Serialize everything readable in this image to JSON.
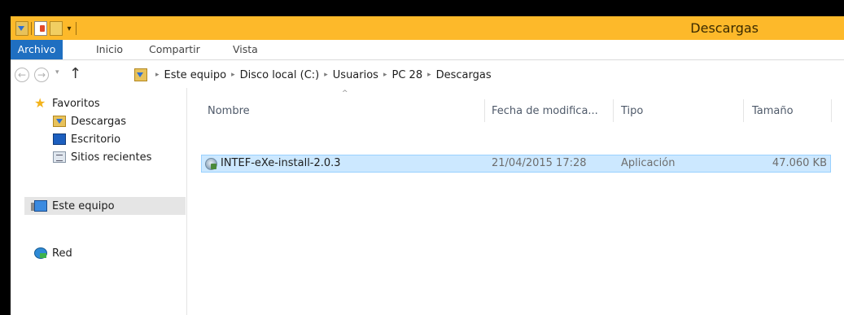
{
  "window": {
    "title": "Descargas"
  },
  "quick_access": {
    "icons": [
      "download-folder-icon",
      "properties-icon",
      "new-folder-icon"
    ],
    "customize": "▾"
  },
  "ribbon": {
    "tabs": [
      {
        "label": "Archivo",
        "active": true
      },
      {
        "label": "Inicio"
      },
      {
        "label": "Compartir"
      },
      {
        "label": "Vista"
      }
    ]
  },
  "address": {
    "back": "←",
    "forward": "→",
    "history": "▾",
    "up": "↑",
    "separator": "▸",
    "crumbs": [
      "Este equipo",
      "Disco local (C:)",
      "Usuarios",
      "PC 28",
      "Descargas"
    ]
  },
  "navpane": {
    "favorites": {
      "label": "Favoritos",
      "icon": "star-icon"
    },
    "fav_items": [
      {
        "label": "Descargas",
        "icon": "download-folder-icon"
      },
      {
        "label": "Escritorio",
        "icon": "desktop-icon"
      },
      {
        "label": "Sitios recientes",
        "icon": "recent-places-icon"
      }
    ],
    "this_pc": {
      "label": "Este equipo",
      "icon": "computer-icon",
      "selected": true
    },
    "network": {
      "label": "Red",
      "icon": "network-icon"
    }
  },
  "filelist": {
    "sort_indicator": "^",
    "columns": [
      "Nombre",
      "Fecha de modifica...",
      "Tipo",
      "Tamaño"
    ],
    "rows": [
      {
        "name": "INTEF-eXe-install-2.0.3",
        "date": "21/04/2015 17:28",
        "type": "Aplicación",
        "size": "47.060 KB",
        "icon": "installer-icon",
        "selected": true
      }
    ]
  },
  "colors": {
    "titlebar": "#fdb92a",
    "file_tab": "#1f6fc1",
    "selection": "#cce8ff",
    "selection_border": "#99d1ff"
  }
}
